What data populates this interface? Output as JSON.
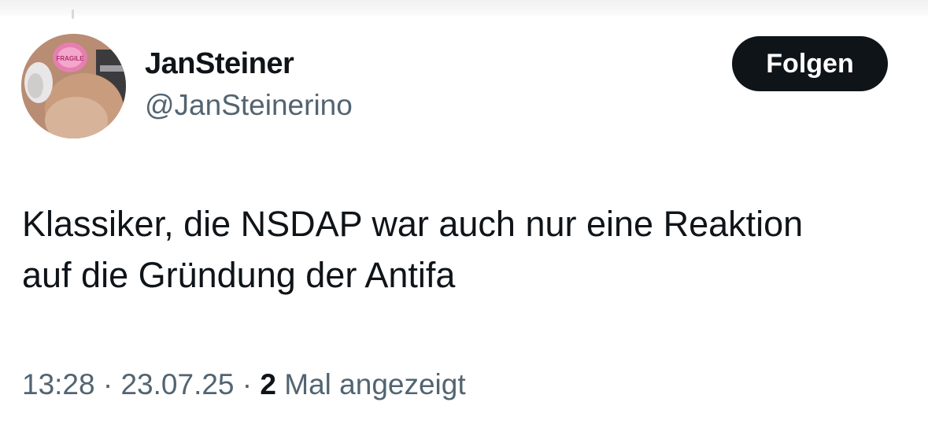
{
  "author": {
    "display_name": "JanSteiner",
    "handle": "@JanSteinerino",
    "avatar_icon": "profile-avatar-cat-with-sticker",
    "avatar_sticker_text": "FRAGILE"
  },
  "actions": {
    "follow_label": "Folgen"
  },
  "tweet": {
    "text_lines": [
      "Klassiker, die NSDAP war auch nur eine Reaktion",
      "auf die Gründung der Antifa"
    ]
  },
  "meta": {
    "time": "13:28",
    "separator": " · ",
    "date": "23.07.25",
    "views_count": "2",
    "views_label": " Mal angezeigt"
  },
  "colors": {
    "text_primary": "#0f1419",
    "text_secondary": "#536471",
    "button_bg": "#0f1419",
    "button_text": "#ffffff"
  }
}
